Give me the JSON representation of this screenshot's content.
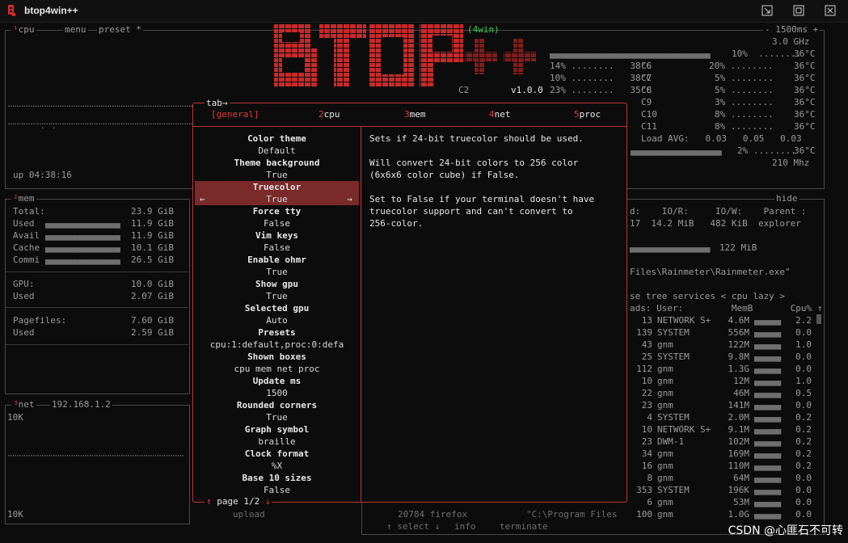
{
  "window": {
    "title": "btop4win++",
    "buttons": [
      "minimize",
      "restore",
      "close"
    ]
  },
  "logo": {
    "badge": "(4win)",
    "version": "v1.0.0"
  },
  "cpu_box": {
    "labels": [
      "¹cpu",
      "menu",
      "preset *"
    ],
    "right_labels": [
      "- 1500ms +",
      "3.0 GHz"
    ],
    "uptime": "up 04:38:16",
    "core_rows": [
      {
        "left": "10%  ........",
        "temp": "36°C"
      },
      {
        "left": "14% ........   38°C",
        "c": "C6",
        "pct": "20% ........",
        "temp": "36°C"
      },
      {
        "left": "10% ........   38°C",
        "c": "C7",
        "pct": "5% ........",
        "temp": "36°C"
      },
      {
        "left": "23% ........   35°C",
        "c": "C8",
        "pct": "5% ........",
        "temp": "36°C"
      },
      {
        "left": "",
        "c": "C9",
        "pct": "3% ........",
        "temp": "36°C"
      },
      {
        "left": "",
        "c": "C10",
        "pct": "8% ........",
        "temp": "36°C"
      },
      {
        "left": "",
        "c": "C11",
        "pct": "8% ........",
        "temp": "36°C"
      }
    ],
    "c2_label": "C2",
    "load_avg": "Load AVG:   0.03   0.05   0.03",
    "pkg_row": "2% ........",
    "pkg_temp": "36°C",
    "freq": "210 Mhz"
  },
  "mem_box": {
    "label": "²mem",
    "rows": [
      {
        "name": "Total:",
        "value": "23.9 GiB"
      },
      {
        "name": "Used",
        "value": "11.9 GiB"
      },
      {
        "name": "Avail",
        "value": "11.9 GiB"
      },
      {
        "name": "Cache",
        "value": "10.1 GiB"
      },
      {
        "name": "Commi",
        "value": "26.5 GiB"
      }
    ],
    "gpu_rows": [
      {
        "name": "GPU:",
        "value": "10.0 GiB"
      },
      {
        "name": "Used",
        "value": "2.07 GiB"
      }
    ],
    "page_rows": [
      {
        "name": "Pagefiles:",
        "value": "7.60 GiB"
      },
      {
        "name": "Used",
        "value": "2.59 GiB"
      }
    ]
  },
  "net_box": {
    "label": "³net",
    "ip": "192.168.1.2",
    "top_scale": "10K",
    "bottom_scale": "10K",
    "upload_label": "upload"
  },
  "proc_box": {
    "hide_label": "hide",
    "io_header": "d:    IO/R:     IO/W:    Parent :",
    "io_values": "17  14.2 MiB   482 KiB  explorer",
    "mem_line": "122 MiB",
    "path": "Files\\Rainmeter\\Rainmeter.exe\"",
    "tabs": "se tree services < cpu lazy >",
    "columns": "ads: User:         MemB       Cpu% ↑",
    "rows": [
      {
        "threads": "13",
        "user": "NETWORK S+",
        "mem": "4.6M",
        "cpu": "2.2"
      },
      {
        "threads": "139",
        "user": "SYSTEM",
        "mem": "556M",
        "cpu": "0.0"
      },
      {
        "threads": "43",
        "user": "gnm",
        "mem": "122M",
        "cpu": "1.0"
      },
      {
        "threads": "25",
        "user": "SYSTEM",
        "mem": "9.8M",
        "cpu": "0.0"
      },
      {
        "threads": "112",
        "user": "gnm",
        "mem": "1.3G",
        "cpu": "0.0"
      },
      {
        "threads": "10",
        "user": "gnm",
        "mem": "12M",
        "cpu": "1.0"
      },
      {
        "threads": "22",
        "user": "gnm",
        "mem": "46M",
        "cpu": "0.5"
      },
      {
        "threads": "23",
        "user": "gnm",
        "mem": "141M",
        "cpu": "0.0"
      },
      {
        "threads": "4",
        "user": "SYSTEM",
        "mem": "2.0M",
        "cpu": "0.2"
      },
      {
        "threads": "10",
        "user": "NETWORK S+",
        "mem": "9.1M",
        "cpu": "0.2"
      },
      {
        "threads": "23",
        "user": "DWM-1",
        "mem": "102M",
        "cpu": "0.2"
      },
      {
        "threads": "34",
        "user": "gnm",
        "mem": "169M",
        "cpu": "0.2"
      },
      {
        "threads": "16",
        "user": "gnm",
        "mem": "110M",
        "cpu": "0.2"
      },
      {
        "threads": "8",
        "user": "gnm",
        "mem": "64M",
        "cpu": "0.0"
      },
      {
        "threads": "353",
        "user": "SYSTEM",
        "mem": "196K",
        "cpu": "0.0"
      },
      {
        "threads": "6",
        "user": "gnm",
        "mem": "53M",
        "cpu": "0.0"
      },
      {
        "threads": "100",
        "user": "gnm",
        "mem": "1.0G",
        "cpu": "0.0"
      }
    ],
    "bottom_process": "20784 firefox           \"C:\\Program Files",
    "footer": [
      "↑ select ↓",
      "info",
      "terminate"
    ]
  },
  "options": {
    "tab_hint": "tab→",
    "tabs": [
      {
        "key": "",
        "label": "[general]",
        "active": true
      },
      {
        "key": "2",
        "label": "cpu"
      },
      {
        "key": "3",
        "label": "mem"
      },
      {
        "key": "4",
        "label": "net"
      },
      {
        "key": "5",
        "label": "proc"
      }
    ],
    "items": [
      {
        "name": "Color theme",
        "value": "Default"
      },
      {
        "name": "Theme background",
        "value": "True"
      },
      {
        "name": "Truecolor",
        "value": "True"
      },
      {
        "name": "Force tty",
        "value": "False"
      },
      {
        "name": "Vim keys",
        "value": "False"
      },
      {
        "name": "Enable ohmr",
        "value": "True"
      },
      {
        "name": "Show gpu",
        "value": "True"
      },
      {
        "name": "Selected gpu",
        "value": "Auto"
      },
      {
        "name": "Presets",
        "value": "cpu:1:default,proc:0:defa"
      },
      {
        "name": "Shown boxes",
        "value": "cpu mem net proc"
      },
      {
        "name": "Update ms",
        "value": "1500"
      },
      {
        "name": "Rounded corners",
        "value": "True"
      },
      {
        "name": "Graph symbol",
        "value": "braille"
      },
      {
        "name": "Clock format",
        "value": "%X"
      },
      {
        "name": "Base 10 sizes",
        "value": "False"
      }
    ],
    "selected_index": 2,
    "arrow_left": "←",
    "arrow_right": "→",
    "description": [
      "Sets if 24-bit truecolor should be used.",
      "",
      "Will convert 24-bit colors to 256 color",
      "(6x6x6 color cube) if False.",
      "",
      "Set to False if your terminal doesn't have",
      "truecolor support and can't convert to",
      "256-color."
    ],
    "page": "page 1/2",
    "page_up": "↑",
    "page_down": "↓"
  },
  "watermark": "CSDN @心匪石不可转",
  "colors": {
    "accent": "#c03434",
    "selected": "#7a2a2a",
    "green": "#39d353"
  }
}
